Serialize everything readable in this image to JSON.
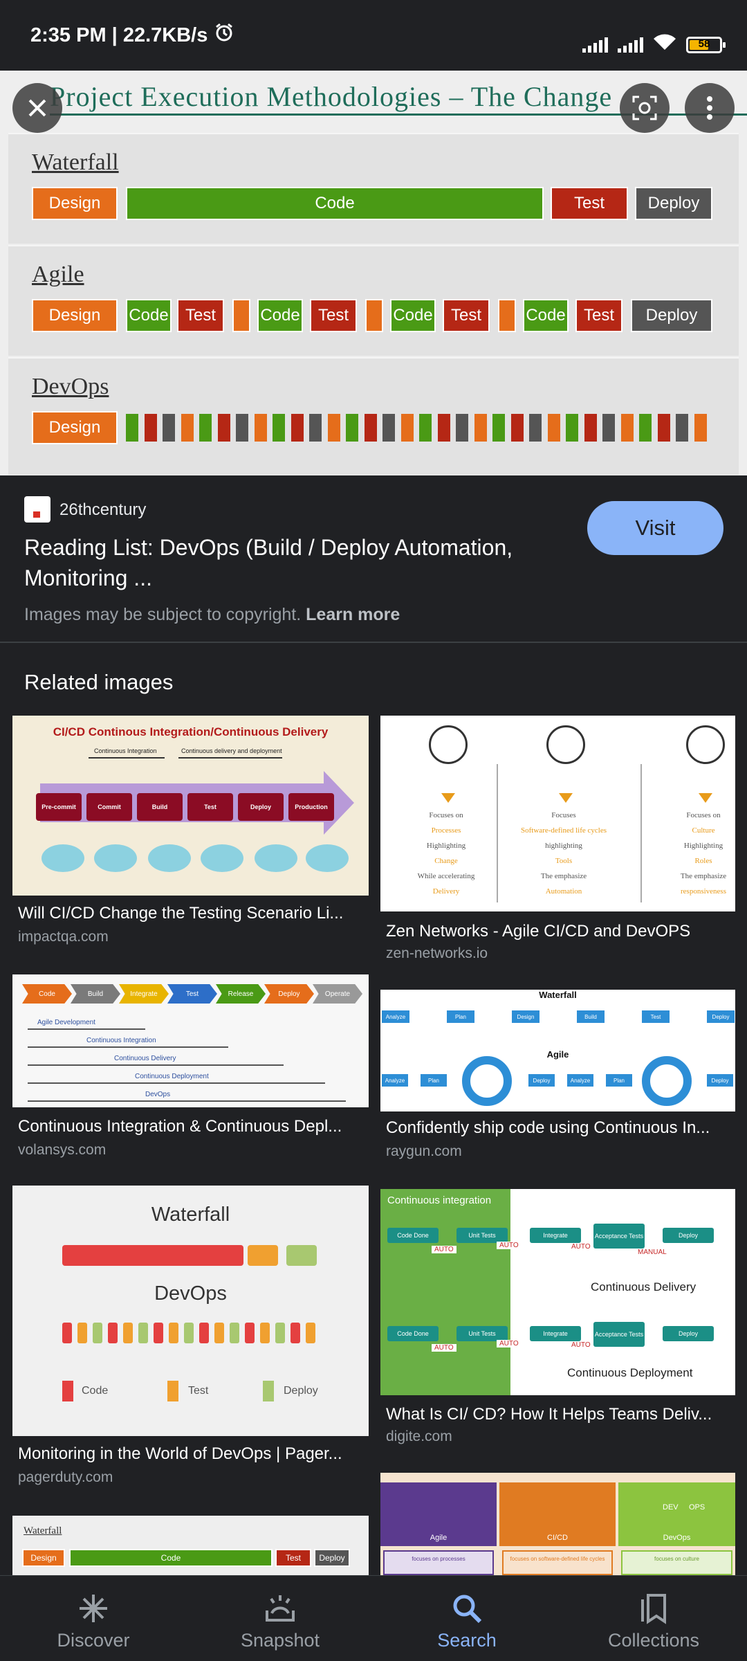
{
  "status": {
    "time": "2:35 PM | 22.7KB/s",
    "battery": "58"
  },
  "hero": {
    "title": "Project Execution Methodologies – The Change",
    "sections": [
      {
        "label": "Waterfall"
      },
      {
        "label": "Agile"
      },
      {
        "label": "DevOps"
      }
    ],
    "waterfall": [
      "Design",
      "Code",
      "Test",
      "Deploy"
    ],
    "agile": [
      "Design",
      "Code",
      "Test",
      "Code",
      "Test",
      "Code",
      "Test",
      "Code",
      "Test",
      "Deploy"
    ],
    "devops": [
      "Design"
    ]
  },
  "source": {
    "site": "26thcentury",
    "title": "Reading List: DevOps (Build / Deploy Automation, Monitoring ...",
    "visit": "Visit",
    "copyright": "Images may be subject to copyright.",
    "learn_more": "Learn more"
  },
  "related": {
    "heading": "Related images",
    "items": [
      {
        "title": "Will CI/CD Change the Testing Scenario Li...",
        "domain": "impactqa.com"
      },
      {
        "title": "Zen Networks - Agile CI/CD and DevOPS",
        "domain": "zen-networks.io"
      },
      {
        "title": "Continuous Integration & Continuous Depl...",
        "domain": "volansys.com"
      },
      {
        "title": "Confidently ship code using Continuous In...",
        "domain": "raygun.com"
      },
      {
        "title": "Monitoring in the World of DevOps | Pager...",
        "domain": "pagerduty.com"
      },
      {
        "title": "What Is CI/ CD? How It Helps Teams Deliv...",
        "domain": "digite.com"
      }
    ],
    "thumb_text": {
      "cicd_title": "CI/CD Continous Integration/Continuous Delivery",
      "cicd_ci": "Continuous Integration",
      "cicd_cd": "Continuous delivery and deployment",
      "cicd_steps": [
        "Pre-commit",
        "Commit",
        "Build",
        "Test",
        "Deploy",
        "Production"
      ],
      "zen_cols": [
        {
          "lines": [
            "Focuses on",
            "Processes",
            "Highlighting",
            "Change",
            "While accelerating",
            "Delivery"
          ]
        },
        {
          "lines": [
            "Focuses",
            "Software-defined life cycles",
            "highlighting",
            "Tools",
            "The emphasize",
            "Automation"
          ]
        },
        {
          "lines": [
            "Focuses on",
            "Culture",
            "Highlighting",
            "Roles",
            "The emphasize",
            "responsiveness"
          ]
        }
      ],
      "volansys_stages": [
        "Code",
        "Build",
        "Integrate",
        "Test",
        "Release",
        "Deploy",
        "Operate"
      ],
      "volansys_lines": [
        "Agile Development",
        "Continuous Integration",
        "Continuous Delivery",
        "Continuous Deployment",
        "DevOps"
      ],
      "raygun_waterfall": "Waterfall",
      "raygun_agile": "Agile",
      "raygun_row1": [
        "Analyze",
        "Plan",
        "Design",
        "Build",
        "Test",
        "Deploy"
      ],
      "raygun_row2": [
        "Analyze",
        "Plan",
        "Deploy",
        "Analyze",
        "Plan",
        "Deploy"
      ],
      "pd_waterfall": "Waterfall",
      "pd_devops": "DevOps",
      "pd_legend": [
        "Code",
        "Test",
        "Deploy"
      ],
      "digite_ci": "Continuous integration",
      "digite_delivery": "Continuous Delivery",
      "digite_deployment": "Continuous Deployment",
      "digite_steps": [
        "Code Done",
        "Unit Tests",
        "Integrate",
        "Acceptance Tests",
        "Deploy"
      ],
      "digite_auto": "AUTO",
      "digite_manual": "MANUAL",
      "bottom_left_label": "Waterfall",
      "bottom_left_bars": [
        "Design",
        "Code",
        "Test",
        "Deploy"
      ],
      "bottom_right": [
        "Agile",
        "CI/CD",
        "DevOps",
        "DEV",
        "OPS"
      ],
      "bottom_right_sub": [
        "focuses on processes",
        "focuses on software-defined life cycles",
        "focuses on culture"
      ]
    }
  },
  "nav": {
    "items": [
      {
        "label": "Discover"
      },
      {
        "label": "Snapshot"
      },
      {
        "label": "Search"
      },
      {
        "label": "Collections"
      }
    ]
  },
  "colors": {
    "accent": "#8ab4f8",
    "background": "#202124"
  }
}
